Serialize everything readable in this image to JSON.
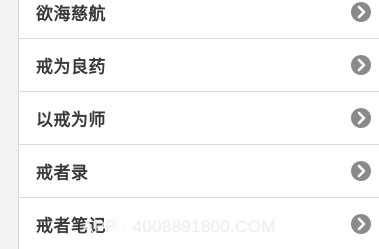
{
  "list": {
    "items": [
      {
        "label": "欲海慈航",
        "icon": "chevron-right-circle-icon"
      },
      {
        "label": "戒为良药",
        "icon": "chevron-right-circle-icon"
      },
      {
        "label": "以戒为师",
        "icon": "chevron-right-circle-icon"
      },
      {
        "label": "戒者录",
        "icon": "chevron-right-circle-icon"
      },
      {
        "label": "戒者笔记",
        "icon": "chevron-right-circle-icon"
      }
    ]
  },
  "watermark": {
    "text": "APP · 4008891800.COM"
  },
  "colors": {
    "label": "#3a3a3a",
    "chevron_bg": "#8a8a8a",
    "divider": "#dcdcdc",
    "background": "#ffffff",
    "side_gutter": "#f2f2f2"
  }
}
